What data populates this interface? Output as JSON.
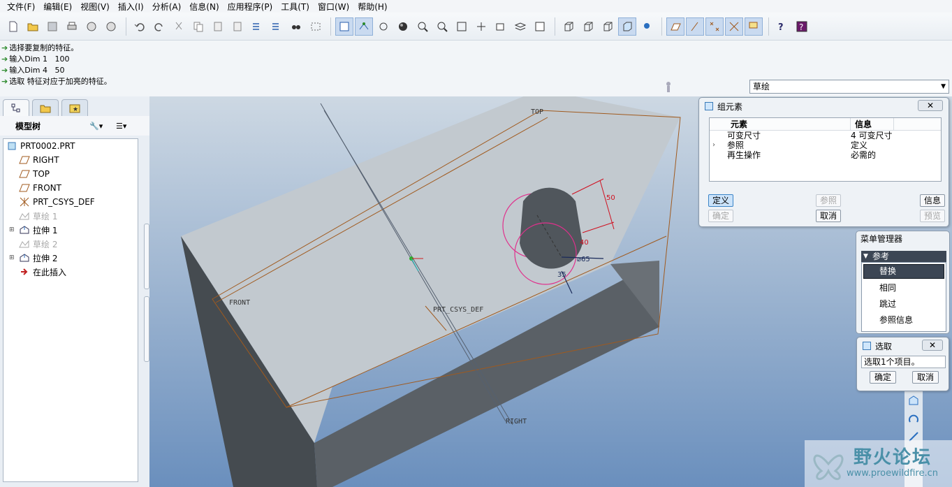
{
  "menubar": [
    "文件(F)",
    "编辑(E)",
    "视图(V)",
    "插入(I)",
    "分析(A)",
    "信息(N)",
    "应用程序(P)",
    "工具(T)",
    "窗口(W)",
    "帮助(H)"
  ],
  "messages": [
    "选择要复制的特征。",
    "输入Dim 1   100",
    "输入Dim 4   50",
    "选取 特征对应于加亮的特征。"
  ],
  "filter": {
    "value": "草绘"
  },
  "model_tree": {
    "title": "模型树",
    "items": [
      {
        "label": "PRT0002.PRT",
        "icon": "part-icon",
        "dim": false
      },
      {
        "label": "RIGHT",
        "icon": "datum-plane-icon",
        "dim": false
      },
      {
        "label": "TOP",
        "icon": "datum-plane-icon",
        "dim": false
      },
      {
        "label": "FRONT",
        "icon": "datum-plane-icon",
        "dim": false
      },
      {
        "label": "PRT_CSYS_DEF",
        "icon": "csys-icon",
        "dim": false
      },
      {
        "label": "草绘 1",
        "icon": "sketch-icon",
        "dim": true
      },
      {
        "label": "拉伸 1",
        "icon": "extrude-icon",
        "dim": false
      },
      {
        "label": "草绘 2",
        "icon": "sketch-icon",
        "dim": true
      },
      {
        "label": "拉伸 2",
        "icon": "extrude-icon",
        "dim": false
      },
      {
        "label": "在此插入",
        "icon": "insert-arrow-icon",
        "dim": false
      }
    ]
  },
  "viewport": {
    "labels": {
      "top": "TOP",
      "front": "FRONT",
      "right": "RIGHT",
      "csys": "PRT_CSYS_DEF"
    },
    "dims": {
      "d50": "50",
      "d40": "40",
      "d35": "35",
      "dsymbol": "⌀65"
    }
  },
  "group_dialog": {
    "title": "组元素",
    "col_element": "元素",
    "col_info": "信息",
    "rows": [
      {
        "element": "可变尺寸",
        "info": "4 可变尺寸"
      },
      {
        "element": "参照",
        "info": "定义"
      },
      {
        "element": "再生操作",
        "info": "必需的"
      }
    ],
    "buttons": {
      "define": "定义",
      "ref": "参照",
      "info": "信息",
      "ok": "确定",
      "cancel": "取消",
      "preview": "预览"
    }
  },
  "menu_manager": {
    "title": "菜单管理器",
    "header": "参考",
    "items": [
      "替换",
      "相同",
      "跳过",
      "参照信息"
    ]
  },
  "select_dialog": {
    "title": "选取",
    "text": "选取1个项目。",
    "ok": "确定",
    "cancel": "取消"
  },
  "watermark": {
    "text": "野火论坛",
    "url": "www.proewildfire.cn"
  },
  "colors": {
    "accent": "#3c4654",
    "datum": "#a05a1e",
    "dimension": "#d01020",
    "highlight": "#e0308c"
  }
}
